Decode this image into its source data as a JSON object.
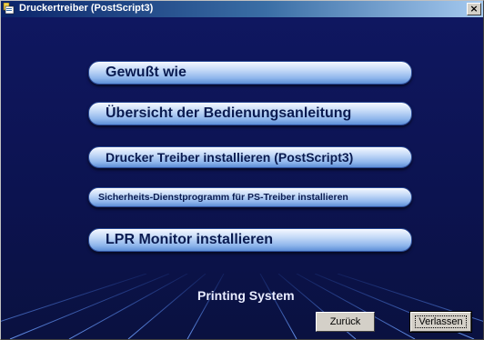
{
  "window": {
    "title": "Druckertreiber (PostScript3)",
    "close_glyph": "×"
  },
  "menu": {
    "items": [
      {
        "label": "Gewußt wie"
      },
      {
        "label": "Übersicht der Bedienungsanleitung"
      },
      {
        "label": "Drucker Treiber installieren (PostScript3)"
      },
      {
        "label": "Sicherheits-Dienstprogramm für PS-Treiber installieren"
      },
      {
        "label": "LPR Monitor installieren"
      }
    ]
  },
  "footer": {
    "system_label": "Printing System",
    "back_label": "Zurück",
    "exit_label": "Verlassen"
  },
  "colors": {
    "title_start": "#0a246a",
    "title_end": "#a6caf0",
    "background": "#0c1450",
    "button_face": "#c8dcf8",
    "grid_line": "#3b6dd8"
  }
}
